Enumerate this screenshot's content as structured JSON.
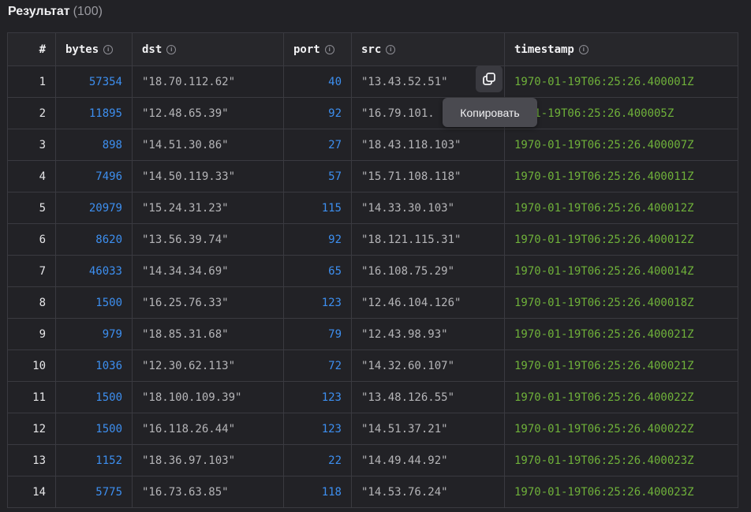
{
  "header": {
    "title": "Результат",
    "count": "(100)"
  },
  "columns": {
    "idx": "#",
    "bytes": "bytes",
    "dst": "dst",
    "port": "port",
    "src": "src",
    "timestamp": "timestamp"
  },
  "info_icon": "info-circle-icon",
  "tooltip": {
    "label": "Копировать"
  },
  "rows": [
    {
      "idx": "1",
      "bytes": "57354",
      "dst": "\"18.70.112.62\"",
      "port": "40",
      "src": "\"13.43.52.51\"",
      "timestamp": "1970-01-19T06:25:26.400001Z"
    },
    {
      "idx": "2",
      "bytes": "11895",
      "dst": "\"12.48.65.39\"",
      "port": "92",
      "src": "\"16.79.101.",
      "timestamp": "0-01-19T06:25:26.400005Z"
    },
    {
      "idx": "3",
      "bytes": "898",
      "dst": "\"14.51.30.86\"",
      "port": "27",
      "src": "\"18.43.118.103\"",
      "timestamp": "1970-01-19T06:25:26.400007Z"
    },
    {
      "idx": "4",
      "bytes": "7496",
      "dst": "\"14.50.119.33\"",
      "port": "57",
      "src": "\"15.71.108.118\"",
      "timestamp": "1970-01-19T06:25:26.400011Z"
    },
    {
      "idx": "5",
      "bytes": "20979",
      "dst": "\"15.24.31.23\"",
      "port": "115",
      "src": "\"14.33.30.103\"",
      "timestamp": "1970-01-19T06:25:26.400012Z"
    },
    {
      "idx": "6",
      "bytes": "8620",
      "dst": "\"13.56.39.74\"",
      "port": "92",
      "src": "\"18.121.115.31\"",
      "timestamp": "1970-01-19T06:25:26.400012Z"
    },
    {
      "idx": "7",
      "bytes": "46033",
      "dst": "\"14.34.34.69\"",
      "port": "65",
      "src": "\"16.108.75.29\"",
      "timestamp": "1970-01-19T06:25:26.400014Z"
    },
    {
      "idx": "8",
      "bytes": "1500",
      "dst": "\"16.25.76.33\"",
      "port": "123",
      "src": "\"12.46.104.126\"",
      "timestamp": "1970-01-19T06:25:26.400018Z"
    },
    {
      "idx": "9",
      "bytes": "979",
      "dst": "\"18.85.31.68\"",
      "port": "79",
      "src": "\"12.43.98.93\"",
      "timestamp": "1970-01-19T06:25:26.400021Z"
    },
    {
      "idx": "10",
      "bytes": "1036",
      "dst": "\"12.30.62.113\"",
      "port": "72",
      "src": "\"14.32.60.107\"",
      "timestamp": "1970-01-19T06:25:26.400021Z"
    },
    {
      "idx": "11",
      "bytes": "1500",
      "dst": "\"18.100.109.39\"",
      "port": "123",
      "src": "\"13.48.126.55\"",
      "timestamp": "1970-01-19T06:25:26.400022Z"
    },
    {
      "idx": "12",
      "bytes": "1500",
      "dst": "\"16.118.26.44\"",
      "port": "123",
      "src": "\"14.51.37.21\"",
      "timestamp": "1970-01-19T06:25:26.400022Z"
    },
    {
      "idx": "13",
      "bytes": "1152",
      "dst": "\"18.36.97.103\"",
      "port": "22",
      "src": "\"14.49.44.92\"",
      "timestamp": "1970-01-19T06:25:26.400023Z"
    },
    {
      "idx": "14",
      "bytes": "5775",
      "dst": "\"16.73.63.85\"",
      "port": "118",
      "src": "\"14.53.76.24\"",
      "timestamp": "1970-01-19T06:25:26.400023Z"
    }
  ]
}
